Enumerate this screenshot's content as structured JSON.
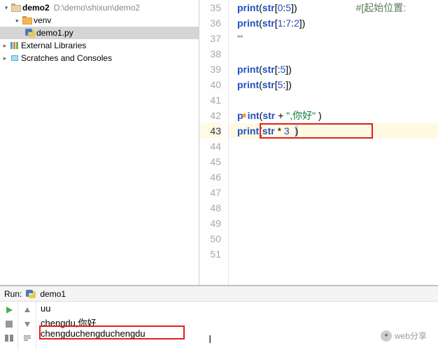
{
  "project_tree": {
    "root": {
      "name": "demo2",
      "path": "D:\\demo\\shixun\\demo2"
    },
    "venv": "venv",
    "file": "demo1.py",
    "external": "External Libraries",
    "scratches": "Scratches and Consoles"
  },
  "editor": {
    "lines": [
      {
        "n": 35
      },
      {
        "n": 36
      },
      {
        "n": 37
      },
      {
        "n": 38
      },
      {
        "n": 39
      },
      {
        "n": 40
      },
      {
        "n": 41
      },
      {
        "n": 42
      },
      {
        "n": 43
      },
      {
        "n": 44
      },
      {
        "n": 45
      },
      {
        "n": 46
      },
      {
        "n": 47
      },
      {
        "n": 48
      },
      {
        "n": 49
      },
      {
        "n": 50
      },
      {
        "n": 51
      }
    ],
    "current_line": 43,
    "code": {
      "l35_a": "print",
      "l35_b": "(",
      "l35_c": "str",
      "l35_d": "[",
      "l35_e": "0",
      "l35_f": ":",
      "l35_g": "5",
      "l35_h": "])",
      "l35_comment": "#[起始位置:",
      "l36_a": "print",
      "l36_b": "(",
      "l36_c": "str",
      "l36_d": "[",
      "l36_e": "1",
      "l36_f": ":",
      "l36_g": "7",
      "l36_h": ":",
      "l36_i": "2",
      "l36_j": "])",
      "l37": "'''",
      "l39_a": "print",
      "l39_b": "(",
      "l39_c": "str",
      "l39_d": "[:",
      "l39_e": "5",
      "l39_f": "])",
      "l40_a": "print",
      "l40_b": "(",
      "l40_c": "str",
      "l40_d": "[",
      "l40_e": "5",
      "l40_f": ":])",
      "l42_a": "p",
      "l42_b": "int",
      "l42_c": "(",
      "l42_d": "str",
      "l42_e": " + ",
      "l42_f": "\",你好\"",
      "l42_g": " )",
      "l43_a": "print",
      "l43_b": "(",
      "l43_c": "str",
      "l43_d": " * ",
      "l43_e": "3",
      "l43_f": "  ",
      "l43_g": ")"
    }
  },
  "run": {
    "label": "Run:",
    "tab": "demo1",
    "output": {
      "l0": "uu",
      "l1": "chengdu,你好",
      "l2": "chengduchengduchengdu"
    }
  },
  "watermark": "web分享"
}
